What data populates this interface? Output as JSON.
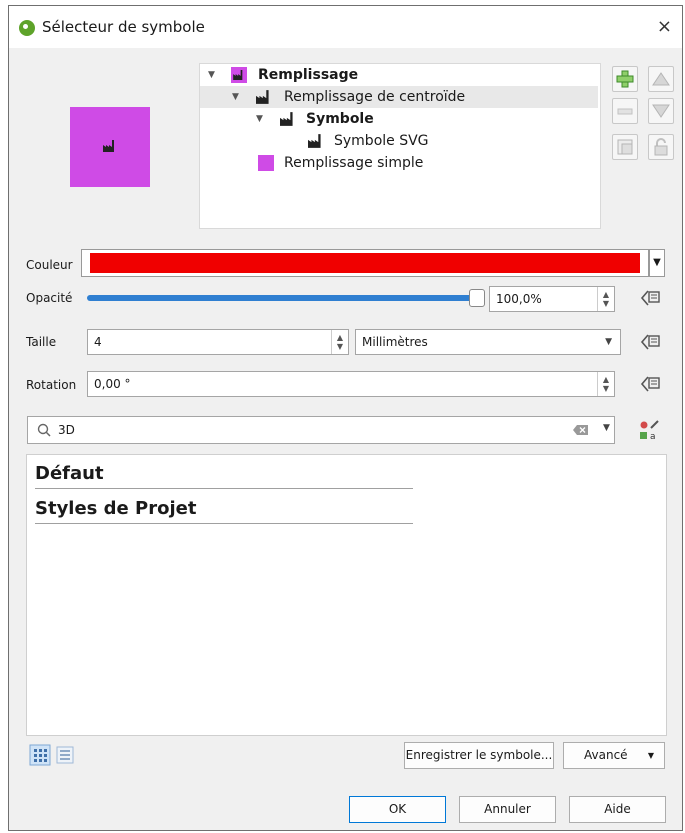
{
  "window": {
    "title": "Sélecteur de symbole",
    "close_glyph": "×"
  },
  "preview": {
    "fill_color": "#cf4be6",
    "icon": "factory-icon"
  },
  "layer_tree": [
    {
      "label": "Remplissage",
      "bold": true,
      "icon": "factory-swatch-icon"
    },
    {
      "label": "Remplissage de centroïde",
      "bold": false,
      "icon": "factory-icon"
    },
    {
      "label": "Symbole",
      "bold": true,
      "icon": "factory-icon"
    },
    {
      "label": "Symbole SVG",
      "bold": false,
      "icon": "factory-icon"
    },
    {
      "label": "Remplissage simple",
      "bold": false,
      "icon": "swatch-icon"
    }
  ],
  "side_buttons": [
    "add-layer",
    "move-up",
    "remove-layer",
    "move-down",
    "duplicate-layer",
    "lock-layer"
  ],
  "properties": {
    "color_label": "Couleur",
    "color_value": "#f00000",
    "opacity_label": "Opacité",
    "opacity_value": "100,0%",
    "opacity_fraction": 1.0,
    "size_label": "Taille",
    "size_value": "4",
    "unit_value": "Millimètres",
    "rotation_label": "Rotation",
    "rotation_value": "0,00 °"
  },
  "search": {
    "value": "3D"
  },
  "groups": [
    "Défaut",
    "Styles de Projet"
  ],
  "footer": {
    "save_symbol": "Enregistrer le symbole...",
    "advanced": "Avancé",
    "ok": "OK",
    "cancel": "Annuler",
    "help": "Aide"
  },
  "colors": {
    "accent": "#2f7fd1",
    "swatch": "#cf4be6",
    "fill": "#f00000"
  }
}
